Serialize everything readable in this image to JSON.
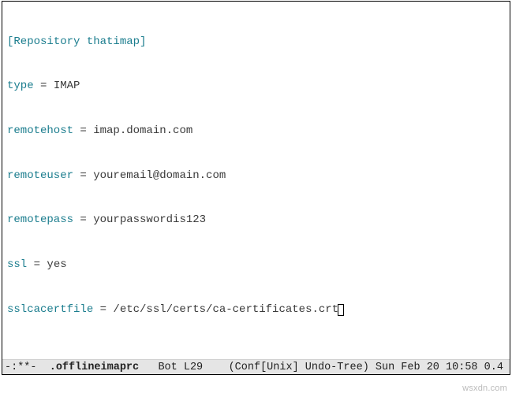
{
  "editor": {
    "lines": [
      {
        "prefix": "[",
        "keyword": "Repository thatimap",
        "suffix": "]",
        "rest": ""
      },
      {
        "keyword": "type",
        "rest": " = IMAP"
      },
      {
        "keyword": "remotehost",
        "rest": " = imap.domain.com"
      },
      {
        "keyword": "remoteuser",
        "rest": " = youremail@domain.com"
      },
      {
        "keyword": "remotepass",
        "rest": " = yourpasswordis123"
      },
      {
        "keyword": "ssl",
        "rest": " = yes"
      },
      {
        "keyword": "sslcacertfile",
        "rest": " = /etc/ssl/certs/ca-certificates.crt",
        "cursor": true
      }
    ]
  },
  "modeline": {
    "status": "-:**-  ",
    "filename": ".offlineimaprc",
    "position": "   Bot L29    ",
    "modes": "(Conf[Unix] Undo-Tree)",
    "time": " Sun Feb 20 10:58 0.4"
  },
  "watermark": "wsxdn.com"
}
